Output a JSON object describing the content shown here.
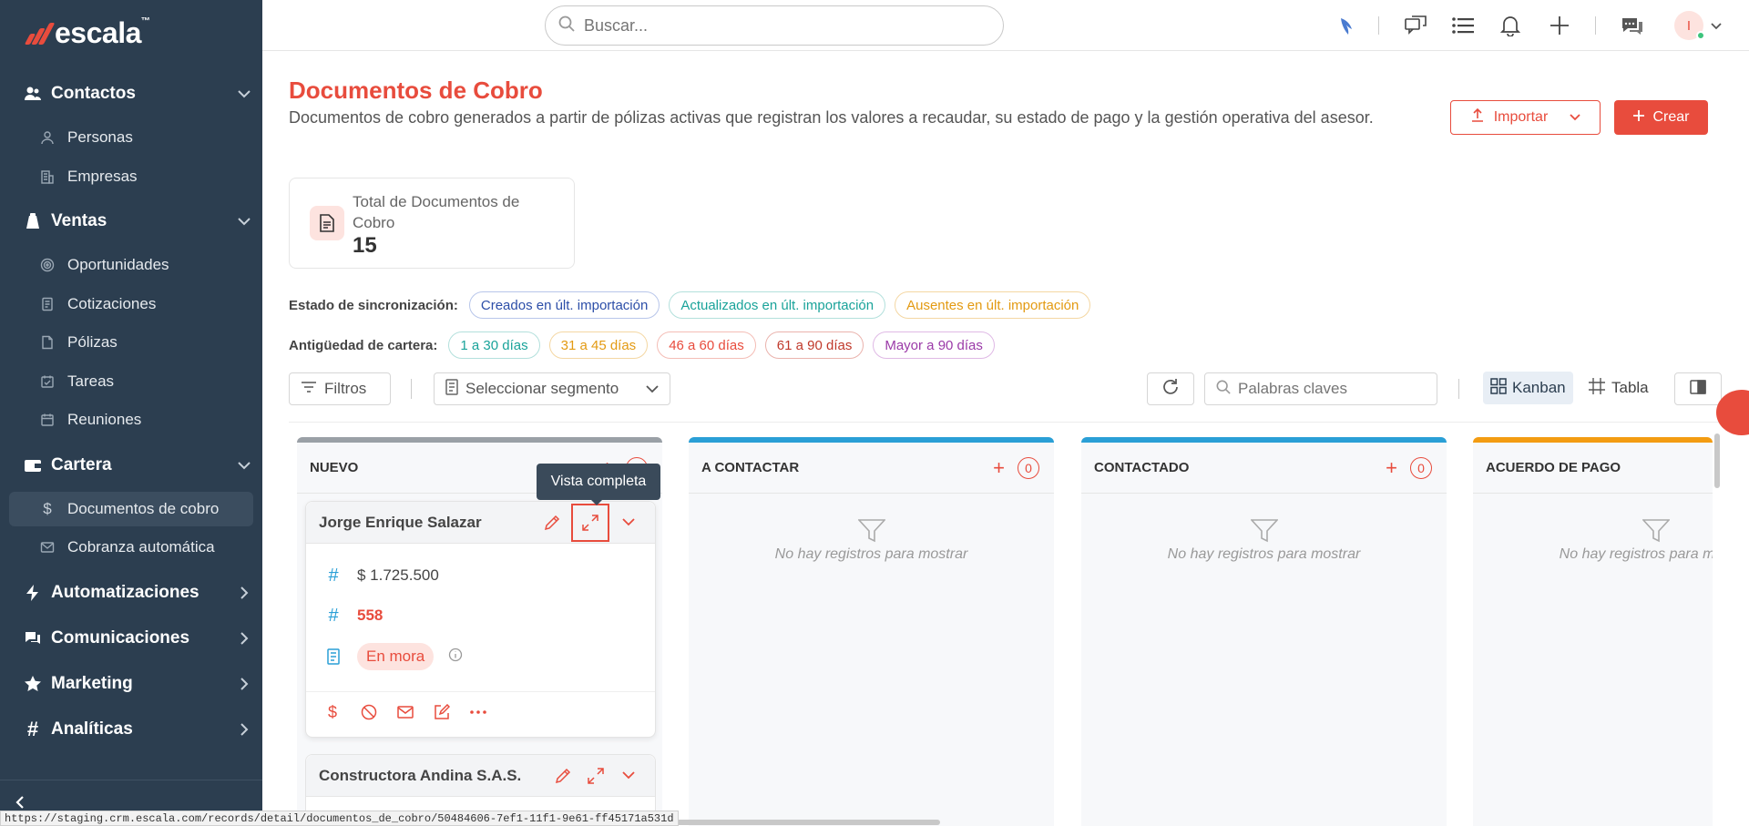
{
  "app": {
    "logo_text": "escala",
    "logo_tm": "™"
  },
  "sidebar": {
    "groups": [
      {
        "label": "Contactos",
        "icon": "contacts-icon",
        "expanded": true,
        "items": [
          {
            "label": "Personas",
            "icon": "person-icon"
          },
          {
            "label": "Empresas",
            "icon": "building-icon"
          }
        ]
      },
      {
        "label": "Ventas",
        "icon": "sales-icon",
        "expanded": true,
        "items": [
          {
            "label": "Oportunidades",
            "icon": "target-icon"
          },
          {
            "label": "Cotizaciones",
            "icon": "document-icon"
          },
          {
            "label": "Pólizas",
            "icon": "file-icon"
          },
          {
            "label": "Tareas",
            "icon": "task-icon"
          },
          {
            "label": "Reuniones",
            "icon": "calendar-icon"
          }
        ]
      },
      {
        "label": "Cartera",
        "icon": "wallet-icon",
        "expanded": true,
        "items": [
          {
            "label": "Documentos de cobro",
            "icon": "dollar-icon",
            "active": true
          },
          {
            "label": "Cobranza automática",
            "icon": "mail-icon"
          }
        ]
      },
      {
        "label": "Automatizaciones",
        "icon": "lightning-icon",
        "expanded": false
      },
      {
        "label": "Comunicaciones",
        "icon": "chat-icon",
        "expanded": false
      },
      {
        "label": "Marketing",
        "icon": "star-icon",
        "expanded": false
      },
      {
        "label": "Analíticas",
        "icon": "hash-icon",
        "expanded": false
      }
    ]
  },
  "topbar": {
    "search_placeholder": "Buscar...",
    "avatar_initial": "I"
  },
  "page": {
    "title": "Documentos de Cobro",
    "description": "Documentos de cobro generados a partir de pólizas activas que registran los valores a recaudar, su estado de pago y la gestión operativa del asesor.",
    "import_label": "Importar",
    "create_label": "Crear",
    "stat": {
      "label": "Total de Documentos de Cobro",
      "value": "15"
    },
    "sync": {
      "label": "Estado de sincronización:",
      "chips": [
        {
          "label": "Creados en últ. importación",
          "color": "#2c4ea8"
        },
        {
          "label": "Actualizados en últ. importación",
          "color": "#1aa39a"
        },
        {
          "label": "Ausentes en últ. importación",
          "color": "#e39a12"
        }
      ]
    },
    "aging": {
      "label": "Antigüedad de cartera:",
      "chips": [
        {
          "label": "1 a 30 días",
          "color": "#1aa39a"
        },
        {
          "label": "31 a 45 días",
          "color": "#e39a12"
        },
        {
          "label": "46 a 60 días",
          "color": "#e84c3d"
        },
        {
          "label": "61 a 90 días",
          "color": "#c0392b"
        },
        {
          "label": "Mayor a 90 días",
          "color": "#9b3aa8"
        }
      ]
    },
    "toolbar": {
      "filters_label": "Filtros",
      "segment_label": "Seleccionar segmento",
      "keywords_placeholder": "Palabras claves",
      "kanban_label": "Kanban",
      "table_label": "Tabla"
    }
  },
  "kanban": {
    "columns": [
      {
        "title": "NUEVO",
        "count": "12",
        "color": "#9aa0a6"
      },
      {
        "title": "A CONTACTAR",
        "count": "0",
        "color": "#2a9fd6"
      },
      {
        "title": "CONTACTADO",
        "count": "0",
        "color": "#2a9fd6"
      },
      {
        "title": "ACUERDO DE PAGO",
        "count": "",
        "color": "#f39c12"
      }
    ],
    "empty_text": "No hay registros para mostrar",
    "cards": [
      {
        "name": "Jorge Enrique Salazar",
        "amount": "$ 1.725.500",
        "number": "558",
        "status": "En mora"
      },
      {
        "name": "Constructora Andina S.A.S."
      }
    ],
    "tooltip": "Vista completa"
  },
  "status_url": "https://staging.crm.escala.com/records/detail/documentos_de_cobro/50484606-7ef1-11f1-9e61-ff45171a531d"
}
